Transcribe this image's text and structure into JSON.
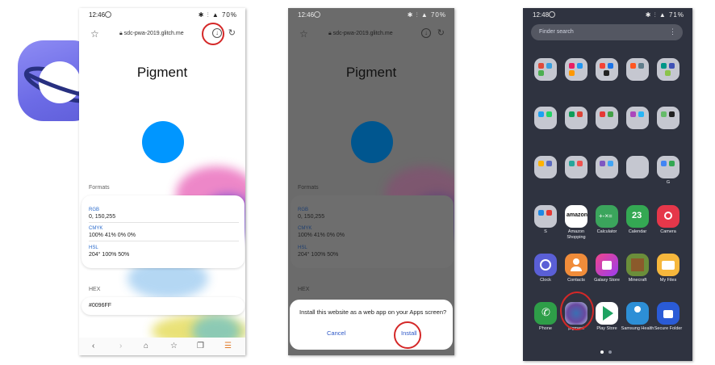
{
  "phone1": {
    "status_time": "12:46",
    "status_right": "70%",
    "url": "sdc-pwa-2019.glitch.me",
    "title": "Pigment",
    "formats_label": "Formats",
    "rgb_label": "RGB",
    "rgb_value": "0, 150,255",
    "cmyk_label": "CMYK",
    "cmyk_value": "100% 41% 0% 0%",
    "hsl_label": "HSL",
    "hsl_value": "204° 100% 50%",
    "hex_label": "HEX",
    "hex_value": "#0096FF"
  },
  "phone2": {
    "status_time": "12:46",
    "status_right": "70%",
    "url": "sdc-pwa-2019.glitch.me",
    "title": "Pigment",
    "formats_label": "Formats",
    "rgb_label": "RGB",
    "rgb_value": "0, 150,255",
    "cmyk_label": "CMYK",
    "cmyk_value": "100% 41% 0% 0%",
    "hsl_label": "HSL",
    "hsl_value": "204° 100% 50%",
    "hex_label": "HEX",
    "dialog_message": "Install this website as a web app on your Apps screen?",
    "cancel_label": "Cancel",
    "install_label": "Install"
  },
  "phone3": {
    "status_time": "12:48",
    "status_right": "71%",
    "search_placeholder": "Finder search",
    "row3_label_s": "S",
    "row3_label_g": "G",
    "apps_row4": [
      "S",
      "Amazon Shopping",
      "Calculator",
      "Calendar",
      "Camera"
    ],
    "apps_row5": [
      "Clock",
      "Contacts",
      "Galaxy Store",
      "Minecraft",
      "My Files"
    ],
    "apps_row6": [
      "Phone",
      "pigment",
      "Play Store",
      "Samsung Health",
      "Secure Folder"
    ],
    "amazon_text": "amazon",
    "calendar_day": "23",
    "calculator_text": "+-×="
  },
  "colors": {
    "pigment_blue": "#0096ff",
    "highlight_red": "#d42828",
    "link_blue": "#2e58c7",
    "logo_purple": "#6c6be6"
  }
}
